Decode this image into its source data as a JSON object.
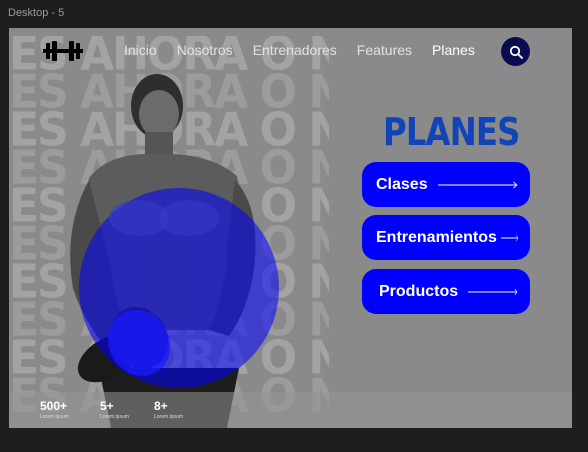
{
  "frame": {
    "label": "Desktop - 5"
  },
  "background": {
    "headline": "ES AHORA O NUNCA"
  },
  "nav": {
    "items": [
      {
        "label": "Inicio"
      },
      {
        "label": "Nosotros"
      },
      {
        "label": "Entrenadores"
      },
      {
        "label": "Features"
      },
      {
        "label": "Planes",
        "active": true
      }
    ]
  },
  "hero": {
    "title": "PLANES",
    "buttons": [
      {
        "label": "Clases"
      },
      {
        "label": "Entrenamientos"
      },
      {
        "label": "Productos"
      }
    ]
  },
  "stats": [
    {
      "value": "500+",
      "caption": "Lorem ipsum"
    },
    {
      "value": "5+",
      "caption": "Lorem ipsum"
    },
    {
      "value": "8+",
      "caption": "Lorem ipsum"
    }
  ],
  "colors": {
    "accent": "#0000ff",
    "title": "#1144b8",
    "search_bg": "#0b0b52",
    "canvas_bg": "#8a8a8a"
  },
  "icons": {
    "logo": "dumbbell-icon",
    "search": "search-icon",
    "arrow": "arrow-right-icon"
  }
}
